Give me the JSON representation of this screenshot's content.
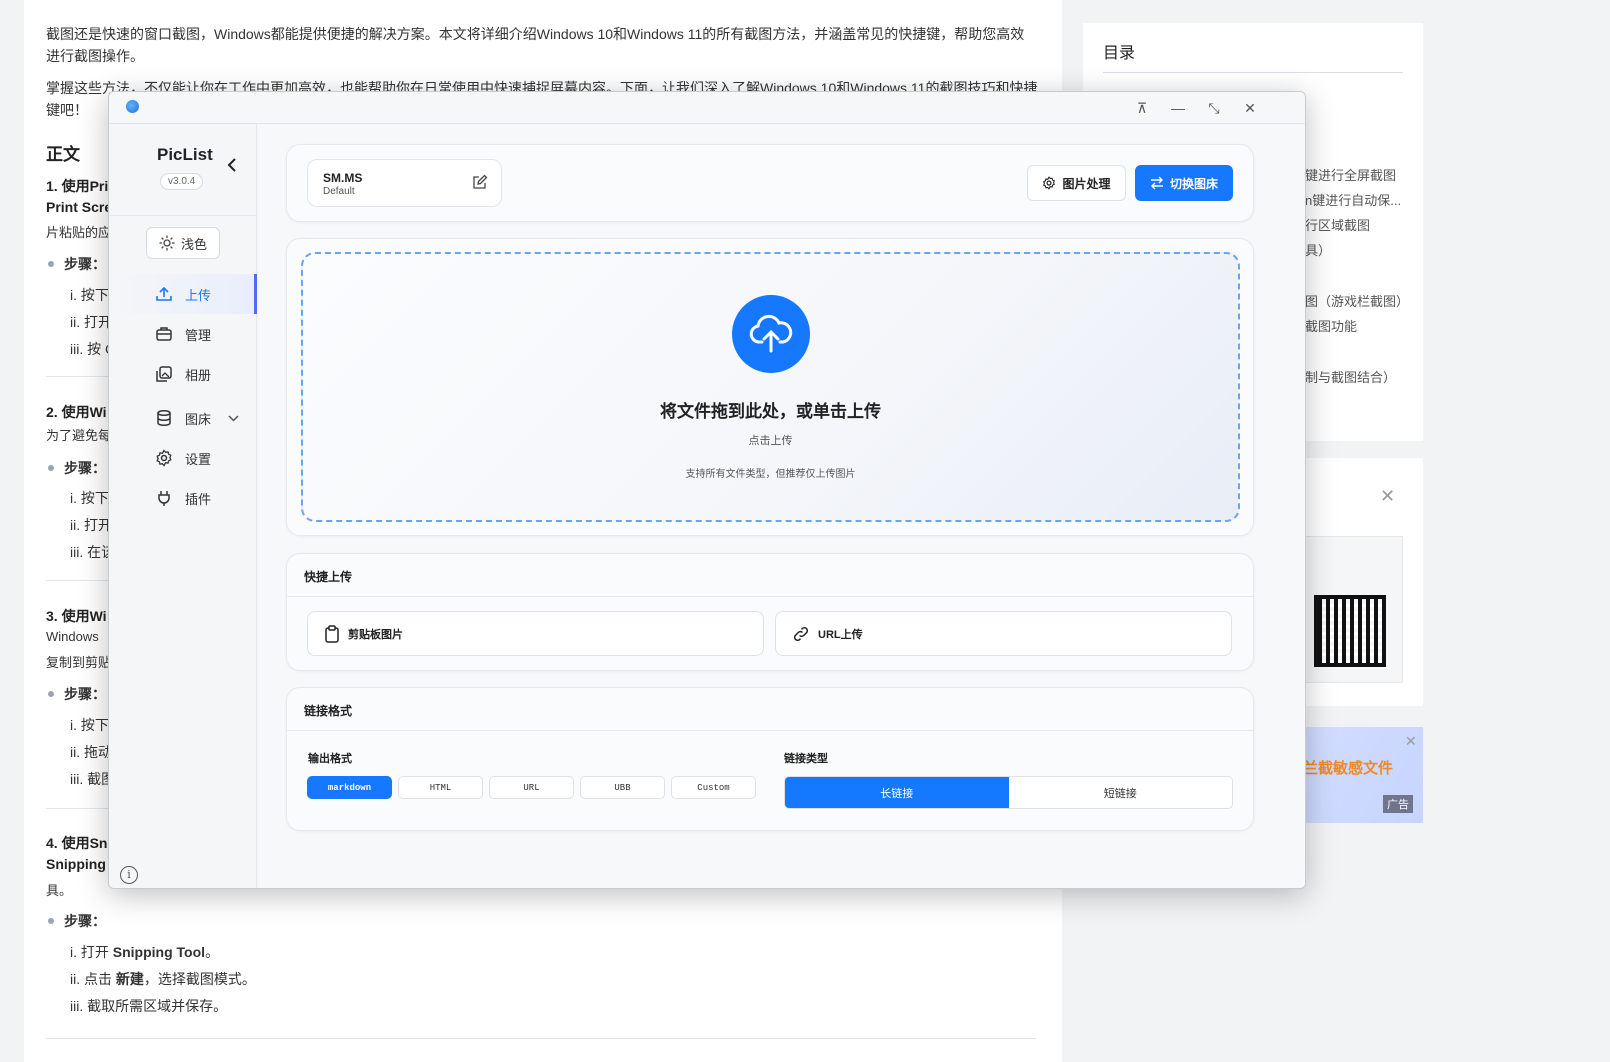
{
  "article": {
    "intro_line1": "截图还是快速的窗口截图，Windows都能提供便捷的解决方案。本文将详细介绍Windows 10和Windows 11的所有截图方法，并涵盖常见的快捷键，帮助您高效",
    "intro_line2": "进行截图操作。",
    "intro_line3": "掌握这些方法，不仅能让你在工作中更加高效，也能帮助你在日常使用中快速捕捉屏幕内容。下面，让我们深入了解Windows 10和Windows 11的截图技巧和快捷",
    "intro_line4": "键吧！",
    "heading": "正文",
    "s1_title": "1. 使用Pri",
    "s1_sub": "Print Scre",
    "s1_text": "片粘贴的应",
    "steps_label": "步骤：",
    "s1_step1": "i. 按下",
    "s1_step2": "ii. 打开",
    "s1_step3": "iii. 按 C",
    "s2_title": "2. 使用Wi",
    "s2_text": "为了避免每",
    "s2_step1": "i. 按下",
    "s2_step2": "ii. 打开",
    "s2_step3": "iii. 在该",
    "s3_title": "3. 使用Wi",
    "s3_text1": "Windows",
    "s3_text2": "复制到剪贴",
    "s3_step1": "i. 按下",
    "s3_step2": "ii. 拖动",
    "s3_step3": "iii. 截图",
    "s4_title": "4. 使用Sn",
    "s4_sub": "Snipping",
    "s4_tail": "具。",
    "s4_step1_pre": "i. 打开 ",
    "s4_step1_b": "Snipping Tool",
    "s4_step1_post": "。",
    "s4_step2_pre": "ii. 点击 ",
    "s4_step2_b": "新建",
    "s4_step2_post": "，选择截图模式。",
    "s4_step3": "iii. 截取所需区域并保存。"
  },
  "toc": {
    "title": "目录",
    "items": [
      "键进行全屏截图",
      "n键进行自动保...",
      "行区域截图",
      "具）",
      "图（游戏栏截图）",
      "截图功能",
      "制与截图结合）"
    ]
  },
  "ad": {
    "text": "兰截敏感文件",
    "tag": "广告"
  },
  "window": {
    "titlebar": {
      "pin": "⊼",
      "minimize": "—",
      "maximize": "⤡",
      "close": "✕"
    },
    "sidebar": {
      "app_name": "PicList",
      "version": "v3.0.4",
      "theme_label": "浅色",
      "nav": [
        {
          "label": "上传",
          "icon": "upload-icon"
        },
        {
          "label": "管理",
          "icon": "briefcase-icon"
        },
        {
          "label": "相册",
          "icon": "gallery-icon"
        },
        {
          "label": "图床",
          "icon": "database-icon"
        },
        {
          "label": "设置",
          "icon": "gear-icon"
        },
        {
          "label": "插件",
          "icon": "plug-icon"
        }
      ]
    },
    "host": {
      "name": "SM.MS",
      "config": "Default"
    },
    "toolbar": {
      "image_process": "图片处理",
      "switch_host": "切换图床"
    },
    "dropzone": {
      "title": "将文件拖到此处，或单击上传",
      "subtitle": "点击上传",
      "hint": "支持所有文件类型，但推荐仅上传图片"
    },
    "quick_upload": {
      "title": "快捷上传",
      "clipboard": "剪贴板图片",
      "url": "URL上传"
    },
    "link_format": {
      "title": "链接格式",
      "output_label": "输出格式",
      "formats": [
        "markdown",
        "HTML",
        "URL",
        "UBB",
        "Custom"
      ],
      "selected_format": "markdown",
      "link_type_label": "链接类型",
      "link_types": [
        "长链接",
        "短链接"
      ],
      "selected_link_type": "长链接"
    },
    "accent_color": "#1677ff"
  }
}
